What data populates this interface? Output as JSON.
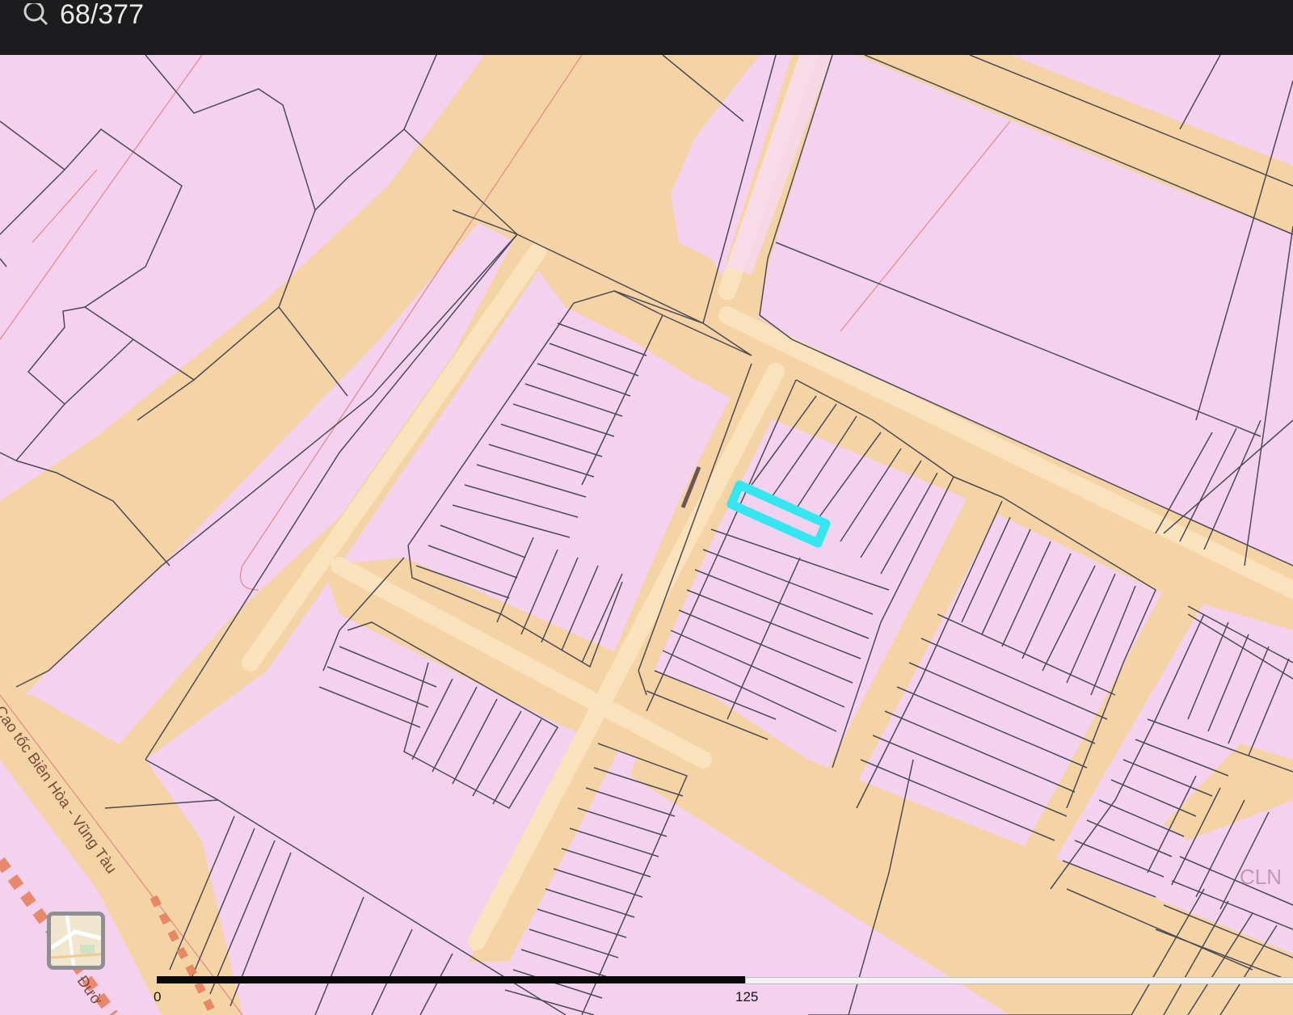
{
  "search": {
    "query": "68/377",
    "icon": "search-icon"
  },
  "map": {
    "colors": {
      "parcel": "#f3d1ef",
      "road": "#f4d3a4",
      "road_center": "#f9e2bc",
      "line": "#4b4b55",
      "plan_line": "#e58c8c",
      "highlight": "#33e6f0"
    },
    "labels": {
      "zone_code": "CLN",
      "road_name": "Cao tốc Biên Hòa - Vũng Tàu",
      "road_name_2": "Đườ"
    },
    "highlighted_parcel": "selected-parcel-outline"
  },
  "scale": {
    "start": "0",
    "mid": "125"
  },
  "layer_button": {
    "icon": "basemap-thumbnail-icon"
  }
}
